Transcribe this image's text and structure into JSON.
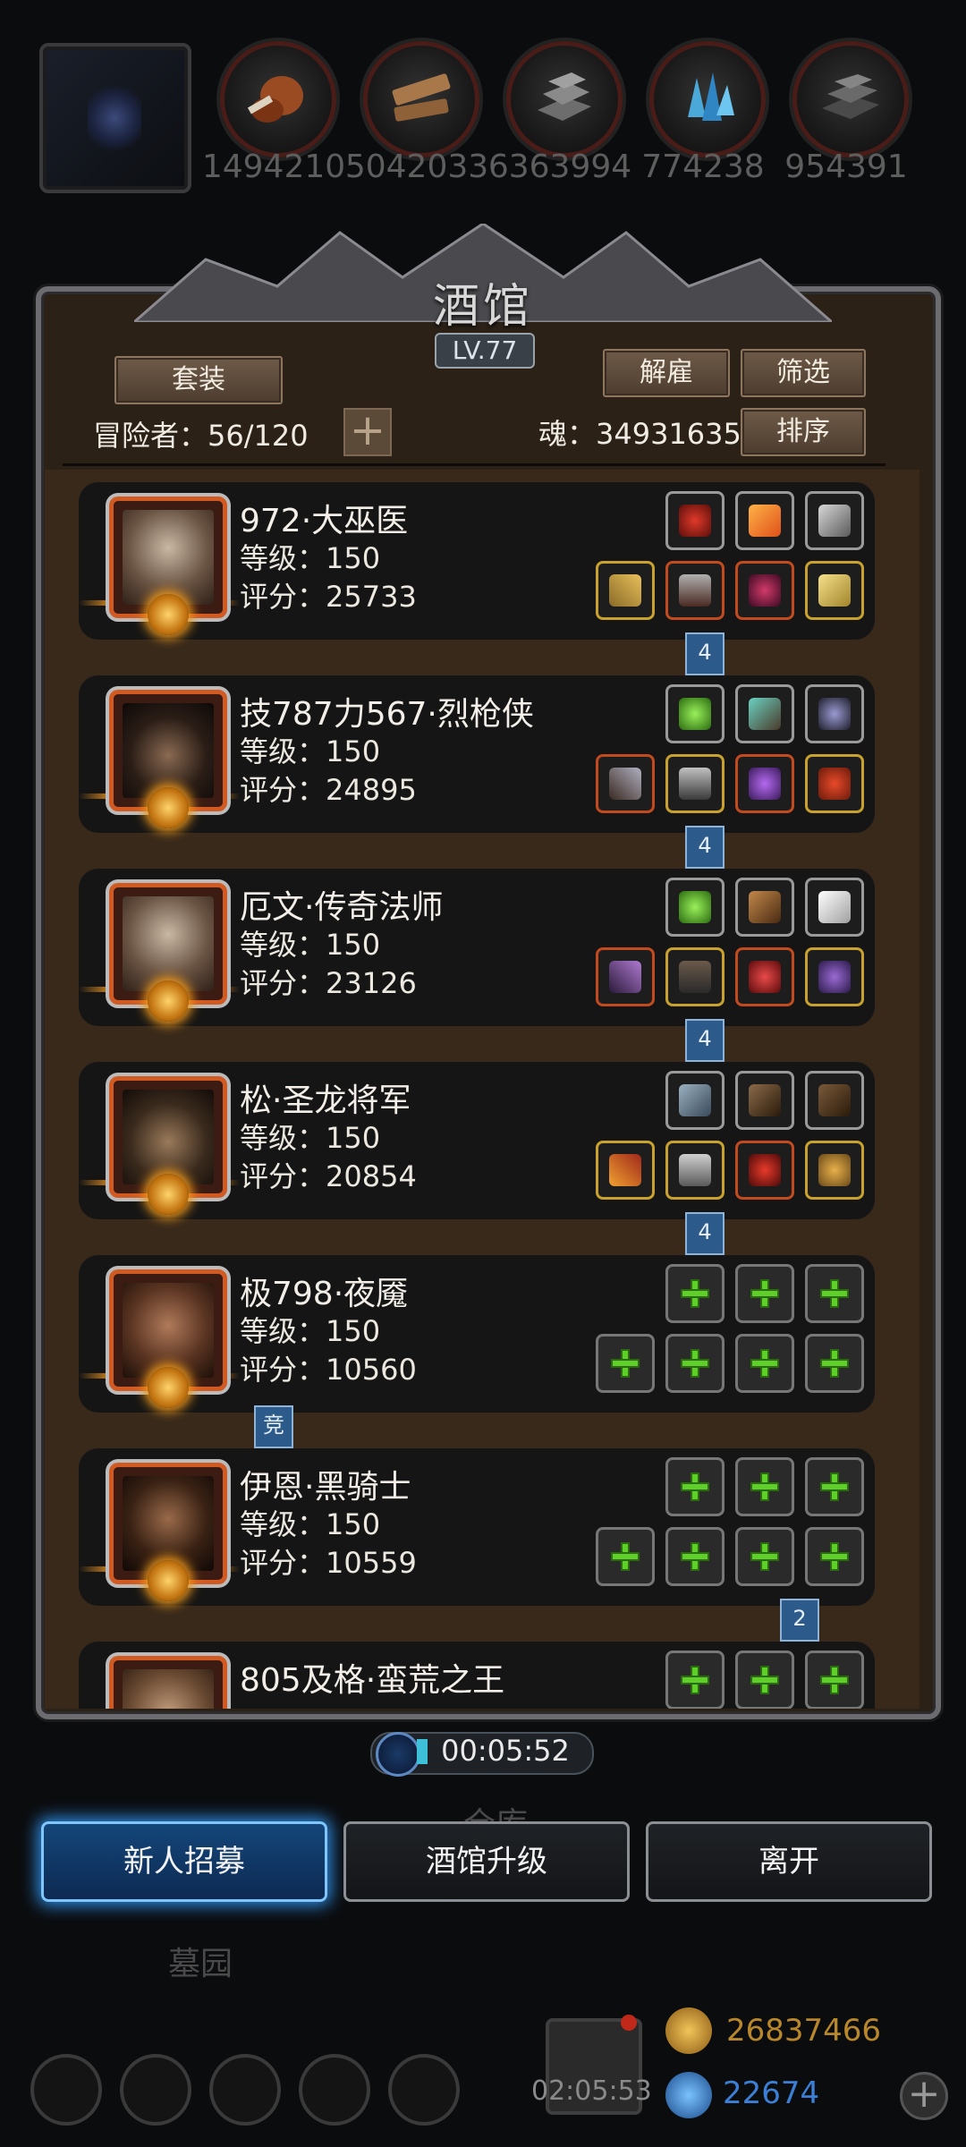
{
  "resources": [
    {
      "icon": "meat-icon",
      "value": "1494210"
    },
    {
      "icon": "wood-icon",
      "value": "5042033"
    },
    {
      "icon": "stone-icon",
      "value": "6363994"
    },
    {
      "icon": "crystal-icon",
      "value": "774238"
    },
    {
      "icon": "iron-icon",
      "value": "954391"
    }
  ],
  "tavern": {
    "title": "酒馆",
    "level": "LV.77",
    "set_btn": "套装",
    "dismiss_btn": "解雇",
    "filter_btn": "筛选",
    "sort_btn": "排序",
    "adventurers_label": "冒险者：56/120",
    "soul_label": "魂：34931635",
    "add_icon": "+"
  },
  "heroes": [
    {
      "name": "972·大巫医",
      "level": "等级：150",
      "score": "评分：25733",
      "tag": "4"
    },
    {
      "name": "技787力567·烈枪侠",
      "level": "等级：150",
      "score": "评分：24895",
      "tag": "4"
    },
    {
      "name": "厄文·传奇法师",
      "level": "等级：150",
      "score": "评分：23126",
      "tag": "4"
    },
    {
      "name": "松·圣龙将军",
      "level": "等级：150",
      "score": "评分：20854",
      "tag": "4"
    },
    {
      "name": "极798·夜魇",
      "level": "等级：150",
      "score": "评分：10560",
      "tag": "竞"
    },
    {
      "name": "伊恩·黑骑士",
      "level": "等级：150",
      "score": "评分：10559",
      "tag": "2"
    },
    {
      "name": "805及格·蛮荒之王",
      "level": "",
      "score": "",
      "tag": ""
    }
  ],
  "timer": "00:05:52",
  "buttons": {
    "recruit": "新人招募",
    "upgrade": "酒馆升级",
    "leave": "离开"
  },
  "background_labels": {
    "warehouse": "仓库",
    "cemetery": "墓园"
  },
  "bottom": {
    "gift_timer": "02:05:53",
    "gold": "26837466",
    "gems": "22674"
  },
  "colors": {
    "gold_text": "#b8862b",
    "gem_text": "#3b7fd6",
    "accent_blue": "#2e8ee6"
  }
}
